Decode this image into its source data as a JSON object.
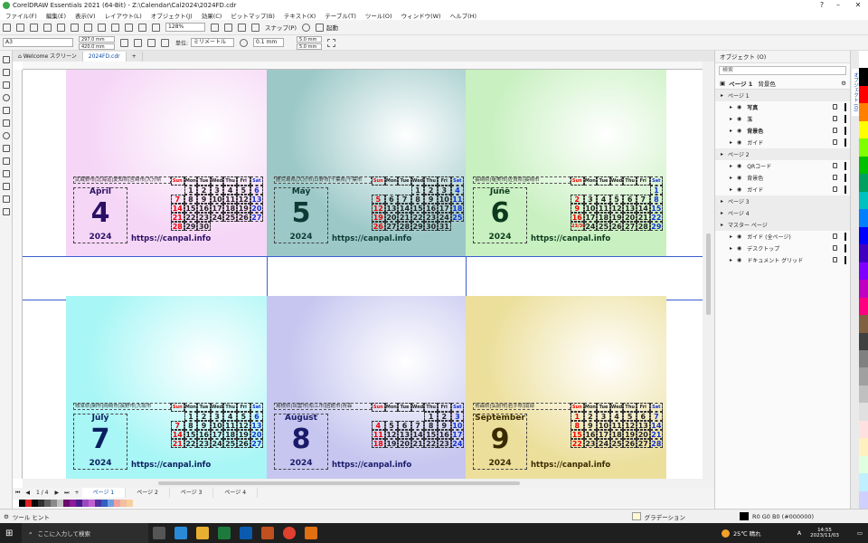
{
  "window": {
    "title": "CorelDRAW Essentials 2021 (64-Bit) - Z:\\Calendar\\Cal2024\\2024FD.cdr"
  },
  "menu": [
    "ファイル(F)",
    "編集(E)",
    "表示(V)",
    "レイアウト(L)",
    "オブジェクト(J)",
    "効果(C)",
    "ビットマップ(B)",
    "テキスト(X)",
    "テーブル(T)",
    "ツール(O)",
    "ウィンドウ(W)",
    "ヘルプ(H)"
  ],
  "toolbar1": {
    "zoom": "128%",
    "snap_label": "スナップ(P)",
    "launch_label": "起動"
  },
  "toolbar2": {
    "paper": "A3",
    "width": "297.0 mm",
    "height": "420.0 mm",
    "unit_label": "単位:",
    "unit": "ミリメートル",
    "nudge": "0.1 mm",
    "dup_x": "5.0 mm",
    "dup_y": "5.0 mm"
  },
  "doc_tabs": [
    "Welcome スクリーン",
    "2024FD.cdr"
  ],
  "page_nav": {
    "counter": "1 / 4",
    "pages": [
      "ページ 1",
      "ページ 2",
      "ページ 3",
      "ページ 4"
    ]
  },
  "objects_panel": {
    "title": "オブジェクト (O)",
    "search_placeholder": "検索",
    "current_page": "ページ 1",
    "current_layer": "背景色",
    "tree": [
      {
        "label": "ページ 1",
        "level": 0,
        "section": true
      },
      {
        "label": "写真",
        "level": 1,
        "bold": true
      },
      {
        "label": "玉",
        "level": 1,
        "bold": true
      },
      {
        "label": "背景色",
        "level": 1,
        "bold": true
      },
      {
        "label": "ガイド",
        "level": 1
      },
      {
        "label": "ページ 2",
        "level": 0,
        "section": true
      },
      {
        "label": "QRコード",
        "level": 1
      },
      {
        "label": "背景色",
        "level": 1
      },
      {
        "label": "ガイド",
        "level": 1
      },
      {
        "label": "ページ 3",
        "level": 0,
        "section": true
      },
      {
        "label": "ページ 4",
        "level": 0,
        "section": true
      },
      {
        "label": "マスター ページ",
        "level": 0,
        "section": true
      },
      {
        "label": "ガイド (全ページ)",
        "level": 1
      },
      {
        "label": "デスクトップ",
        "level": 1
      },
      {
        "label": "ドキュメント グリッド",
        "level": 1
      }
    ],
    "side_tab": "オブジェクト (O)"
  },
  "status": {
    "hint": "ツール ヒント",
    "fill_label": "グラデーション",
    "outline": "R0 G0 B0 (#000000)"
  },
  "taskbar": {
    "search_placeholder": "ここに入力して検索",
    "weather": "25℃ 晴れ",
    "ime": "A",
    "time": "14:55",
    "date": "2023/11/03"
  },
  "weekdays": [
    "Sun",
    "Mon",
    "Tue",
    "Wed",
    "Thu",
    "Fri",
    "Sat"
  ],
  "calendars": [
    {
      "name": "April",
      "num": "4",
      "year": "2024",
      "url": "https://canpal.info",
      "header": "武蔵野市|北海道|愛知県|宮崎市|大分県",
      "bg": [
        "#ffffff",
        "#f6d6f6"
      ],
      "mcolor": "#2a1065",
      "weeks": [
        [
          "",
          "1",
          "2",
          "3",
          "4",
          "5",
          "6"
        ],
        [
          "7",
          "8",
          "9",
          "10",
          "11",
          "12",
          "13"
        ],
        [
          "14",
          "15",
          "16",
          "17",
          "18",
          "19",
          "20"
        ],
        [
          "21",
          "22",
          "23",
          "24",
          "25",
          "26",
          "27"
        ],
        [
          "28",
          "29",
          "30",
          "",
          "",
          "",
          ""
        ]
      ]
    },
    {
      "name": "May",
      "num": "5",
      "year": "2024",
      "url": "https://canpal.info",
      "header": "鹿児島県|大分市|日野市|千葉県|千葉市",
      "bg": [
        "#ffffff",
        "#9cc8c8"
      ],
      "mcolor": "#0c3a34",
      "weeks": [
        [
          "",
          "",
          "",
          "1",
          "2",
          "3",
          "4"
        ],
        [
          "5",
          "6",
          "7",
          "8",
          "9",
          "10",
          "11"
        ],
        [
          "12",
          "13",
          "14",
          "15",
          "16",
          "17",
          "18"
        ],
        [
          "19",
          "20",
          "21",
          "22",
          "23",
          "24",
          "25"
        ],
        [
          "26",
          "27",
          "28",
          "29",
          "30",
          "31",
          ""
        ]
      ]
    },
    {
      "name": "June",
      "num": "6",
      "year": "2024",
      "url": "https://canpal.info",
      "header": "長崎県|奄美市|佐賀県|長崎市",
      "bg": [
        "#ffffff",
        "#c8f0c0"
      ],
      "mcolor": "#0c3a1c",
      "weeks": [
        [
          "",
          "",
          "",
          "",
          "",
          "",
          "1"
        ],
        [
          "2",
          "3",
          "4",
          "5",
          "6",
          "7",
          "8"
        ],
        [
          "9",
          "10",
          "11",
          "12",
          "13",
          "14",
          "15"
        ],
        [
          "16",
          "17",
          "18",
          "19",
          "20",
          "21",
          "22"
        ],
        [
          "23/30",
          "24",
          "25",
          "26",
          "27",
          "28",
          "29"
        ]
      ]
    },
    {
      "name": "July",
      "num": "7",
      "year": "2024",
      "url": "https://canpal.info",
      "header": "岐阜県|関市|岡崎市|長野市|大阪市",
      "bg": [
        "#ffffff",
        "#a8f6f6"
      ],
      "mcolor": "#0c2060",
      "weeks": [
        [
          "",
          "1",
          "2",
          "3",
          "4",
          "5",
          "6"
        ],
        [
          "7",
          "8",
          "9",
          "10",
          "11",
          "12",
          "13"
        ],
        [
          "14",
          "15",
          "16",
          "17",
          "18",
          "19",
          "20"
        ],
        [
          "21",
          "22",
          "23",
          "24",
          "25",
          "26",
          "27"
        ]
      ]
    },
    {
      "name": "August",
      "num": "8",
      "year": "2024",
      "url": "https://canpal.info",
      "header": "島根県|出雲市|松江市|函館市|青森",
      "bg": [
        "#ffffff",
        "#c6c6f0"
      ],
      "mcolor": "#1a1a6a",
      "weeks": [
        [
          "",
          "",
          "",
          "",
          "1",
          "2",
          "3"
        ],
        [
          "4",
          "5",
          "6",
          "7",
          "8",
          "9",
          "10"
        ],
        [
          "11",
          "12",
          "13",
          "14",
          "15",
          "16",
          "17"
        ],
        [
          "18",
          "19",
          "20",
          "21",
          "22",
          "23",
          "24"
        ]
      ]
    },
    {
      "name": "September",
      "num": "9",
      "year": "2024",
      "url": "https://canpal.info",
      "header": "青森県|弘前市|岩手県|南部",
      "bg": [
        "#ffffff",
        "#ecdf9c"
      ],
      "mcolor": "#3a2a00",
      "weeks": [
        [
          "1",
          "2",
          "3",
          "4",
          "5",
          "6",
          "7"
        ],
        [
          "8",
          "9",
          "10",
          "11",
          "12",
          "13",
          "14"
        ],
        [
          "15",
          "16",
          "17",
          "18",
          "19",
          "20",
          "21"
        ],
        [
          "22",
          "23",
          "24",
          "25",
          "26",
          "27",
          "28"
        ]
      ]
    }
  ],
  "colors": {
    "accent": "#0a4aa0",
    "guide": "#3b5fd0"
  }
}
